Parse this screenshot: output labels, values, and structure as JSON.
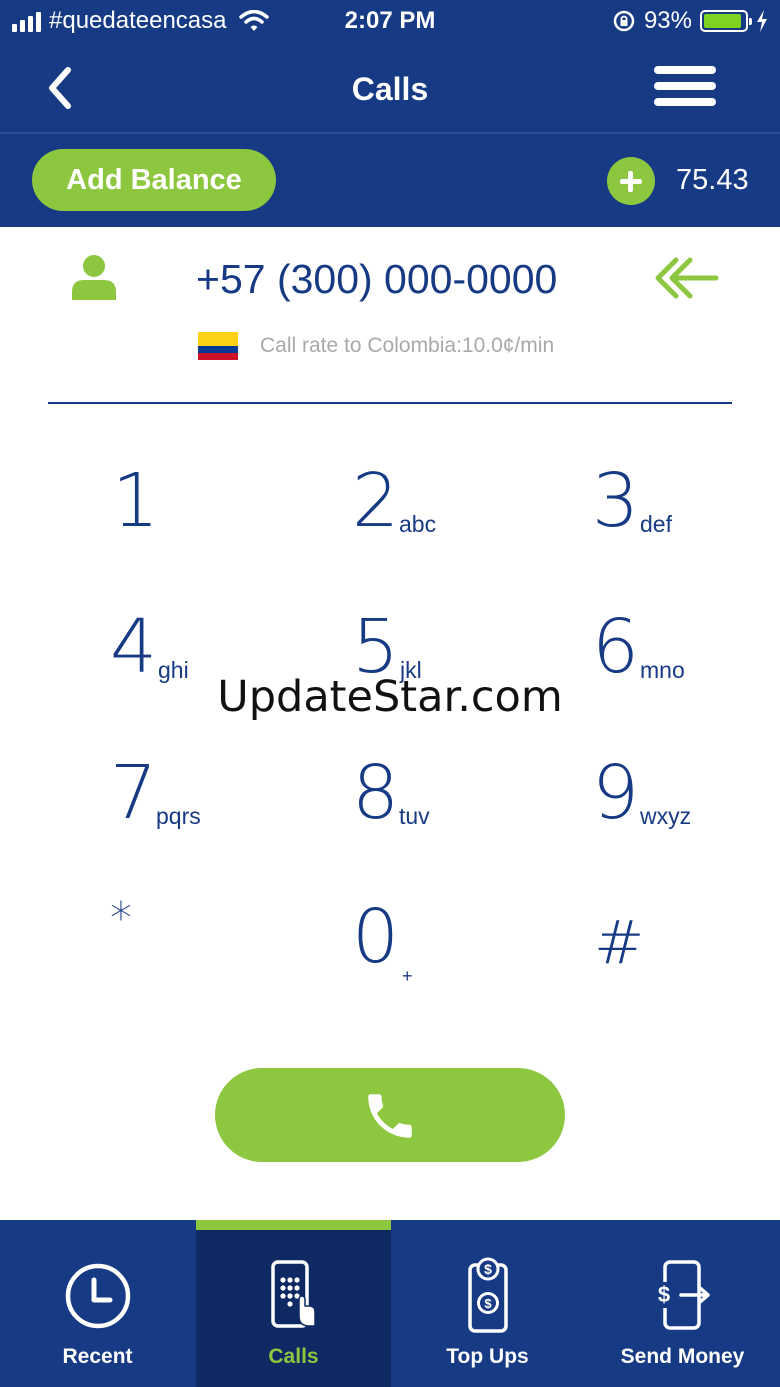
{
  "status_bar": {
    "carrier": "#quedateencasa",
    "time": "2:07 PM",
    "battery_percent": "93%",
    "battery_level": 0.93
  },
  "nav": {
    "title": "Calls",
    "back_icon": "chevron-left-icon",
    "menu_icon": "hamburger-menu-icon"
  },
  "balance": {
    "add_label": "Add Balance",
    "amount": "75.43"
  },
  "dialer": {
    "number": "+57 (300) 000-0000",
    "rate_text": "Call rate to Colombia:10.0¢/min",
    "country_flag": "colombia-flag"
  },
  "keypad": [
    {
      "digit": "1",
      "letters": ""
    },
    {
      "digit": "2",
      "letters": "abc"
    },
    {
      "digit": "3",
      "letters": "def"
    },
    {
      "digit": "4",
      "letters": "ghi"
    },
    {
      "digit": "5",
      "letters": "jkl"
    },
    {
      "digit": "6",
      "letters": "mno"
    },
    {
      "digit": "7",
      "letters": "pqrs"
    },
    {
      "digit": "8",
      "letters": "tuv"
    },
    {
      "digit": "9",
      "letters": "wxyz"
    },
    {
      "digit": "*",
      "letters": ""
    },
    {
      "digit": "0",
      "letters": "+"
    },
    {
      "digit": "#",
      "letters": ""
    }
  ],
  "watermark": "UpdateStar.com",
  "tabs": [
    {
      "label": "Recent",
      "icon": "clock-icon",
      "active": false
    },
    {
      "label": "Calls",
      "icon": "dialpad-phone-icon",
      "active": true
    },
    {
      "label": "Top Ups",
      "icon": "topup-phone-icon",
      "active": false
    },
    {
      "label": "Send Money",
      "icon": "send-money-icon",
      "active": false
    }
  ],
  "colors": {
    "primary": "#173a84",
    "accent": "#8dc63f",
    "rate_text": "#a7a9ac"
  }
}
